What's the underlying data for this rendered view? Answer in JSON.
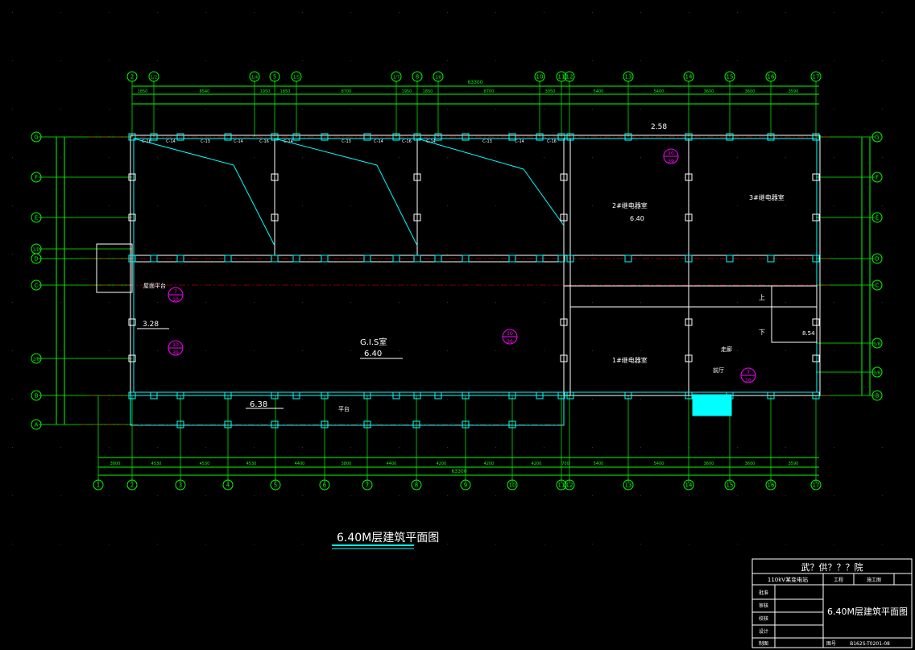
{
  "drawing_title": "6.40M层建筑平面图",
  "title_block": {
    "institute": "武？供？？？院",
    "project": "110kV某变电站",
    "stage_label": "工程",
    "stage_value": "施工图",
    "row_labels": [
      "批准",
      "审核",
      "校核",
      "设计",
      "制图"
    ],
    "sheet_title": "6.40M层建筑平面图",
    "drawing_no_label": "图号",
    "drawing_no": "B162S-T0201-08"
  },
  "axes_top": [
    "2",
    "1/2",
    "1/4",
    "5",
    "1/5",
    "1/7",
    "8",
    "1/8",
    "10",
    "11",
    "12",
    "13",
    "14",
    "15",
    "16",
    "17"
  ],
  "axes_bottom": [
    "1",
    "2",
    "3",
    "4",
    "5",
    "6",
    "7",
    "8",
    "9",
    "10",
    "11",
    "12",
    "13",
    "14",
    "15",
    "16",
    "17"
  ],
  "axes_left": [
    "G",
    "F",
    "E",
    "1/D",
    "D",
    "C",
    "2/B",
    "B",
    "A"
  ],
  "axes_right": [
    "G",
    "F",
    "E",
    "D",
    "C",
    "1/B",
    "2/B",
    "B"
  ],
  "overall_dim": "63300",
  "top_spans": [
    "1850",
    "8540",
    "1950",
    "1850",
    "8700",
    "1950",
    "1850",
    "8700",
    "3050",
    "5400",
    "5400",
    "3600",
    "3600",
    "3590"
  ],
  "bottom_spans": [
    "3800",
    "4530",
    "4530",
    "4530",
    "4400",
    "3800",
    "4400",
    "4200",
    "4200",
    "4200",
    "700",
    "5400",
    "5400",
    "3600",
    "3600",
    "3590"
  ],
  "rooms": {
    "gis": "G.I.S室",
    "gis_elev": "6.40",
    "relay1": "1#继电器室",
    "relay2": "2#继电器室",
    "relay2_elev": "6.40",
    "relay3": "3#继电器室",
    "corridor": "走廊",
    "lobby": "前厅",
    "platform": "平台",
    "platform2": "屋面平台",
    "elev_628": "6.38",
    "elev_328": "3.28",
    "elev_254": "2.58",
    "up": "上",
    "down": "下",
    "stair_elev": "8.54"
  },
  "window_tags": [
    "C-16",
    "C-14",
    "C-13",
    "C-14",
    "C-16",
    "C-14",
    "C-13",
    "C-14",
    "C-16",
    "C-14",
    "C-13",
    "C-14",
    "C-16"
  ],
  "index_markers": [
    {
      "num": "10",
      "sheet": "39"
    },
    {
      "num": "7",
      "sheet": "10"
    },
    {
      "num": "10",
      "sheet": "39"
    },
    {
      "num": "10",
      "sheet": "39"
    },
    {
      "num": "7",
      "sheet": "10"
    }
  ],
  "colors": {
    "background": "#000000",
    "axis": "#00ff00",
    "wall": "#ffffff",
    "column": "#00ffff",
    "window": "#ff00ff",
    "axis_red": "#ff0000",
    "text": "#ffffff",
    "dim": "#00ffff"
  }
}
